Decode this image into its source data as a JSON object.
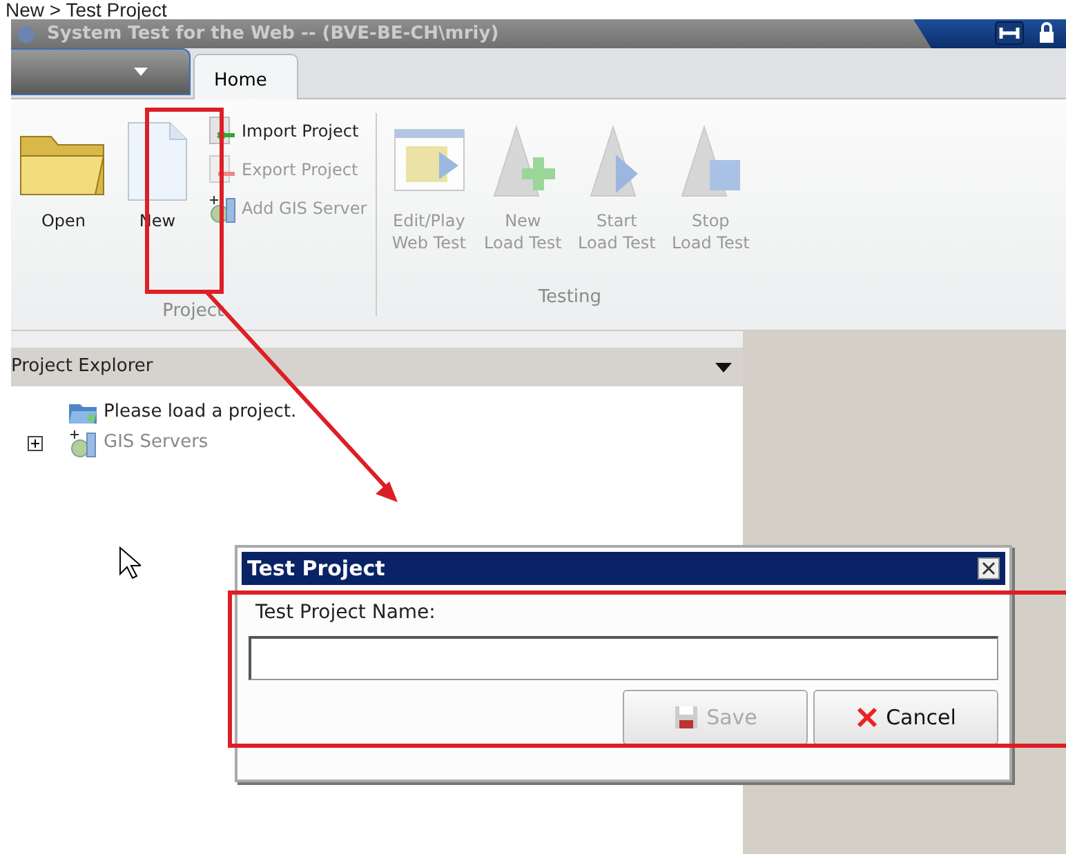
{
  "caption": "New > Test Project",
  "window": {
    "title": "System Test for the Web -- (BVE-BE-CH\\mriy)"
  },
  "tabs": [
    {
      "label": "Home",
      "selected": true
    }
  ],
  "ribbon": {
    "groups": [
      {
        "label": "Project",
        "buttons": [
          {
            "kind": "large",
            "label": "Open",
            "disabled": false
          },
          {
            "kind": "large",
            "label": "New",
            "disabled": false
          },
          {
            "kind": "small",
            "label": "Import Project",
            "disabled": false
          },
          {
            "kind": "small",
            "label": "Export Project",
            "disabled": true
          },
          {
            "kind": "small",
            "label": "Add GIS Server",
            "disabled": true
          }
        ]
      },
      {
        "label": "Testing",
        "buttons": [
          {
            "kind": "large",
            "label": "Edit/Play\nWeb Test",
            "disabled": true
          },
          {
            "kind": "large",
            "label": "New\nLoad Test",
            "disabled": true
          },
          {
            "kind": "large",
            "label": "Start\nLoad Test",
            "disabled": true
          },
          {
            "kind": "large",
            "label": "Stop\nLoad Test",
            "disabled": true
          }
        ]
      }
    ]
  },
  "explorer": {
    "title": "Project Explorer",
    "items": [
      {
        "label": "Please load a project.",
        "disabled": false
      },
      {
        "label": "GIS Servers",
        "expanded": false,
        "disabled": true
      }
    ]
  },
  "dialog": {
    "title": "Test Project",
    "field_label": "Test Project Name:",
    "buttons": [
      {
        "kind": "save",
        "label": "Save",
        "disabled": true
      },
      {
        "kind": "cancel",
        "label": "Cancel",
        "disabled": false
      }
    ]
  }
}
